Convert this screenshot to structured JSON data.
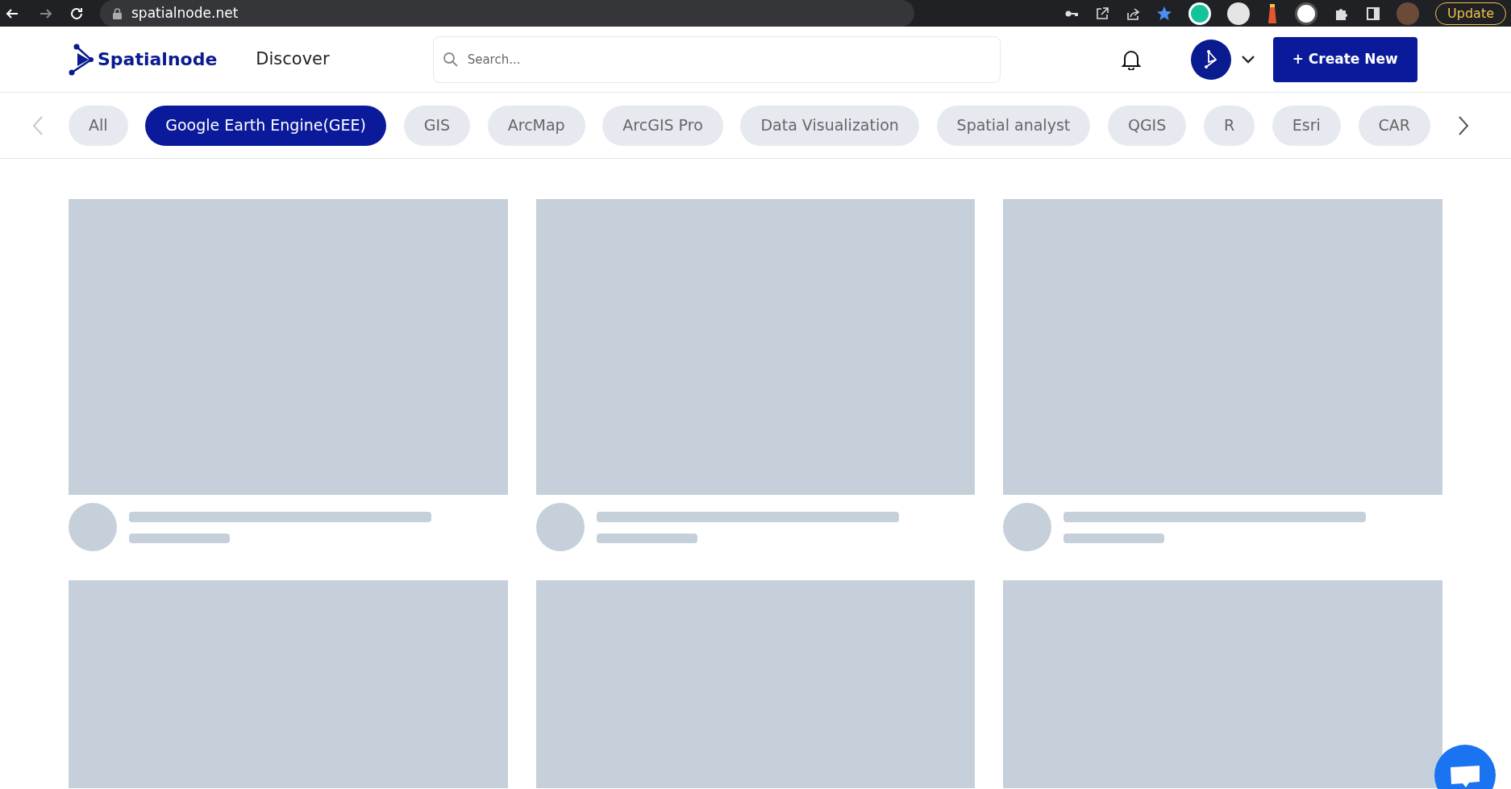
{
  "browser": {
    "url": "spatialnode.net",
    "update_button": "Update"
  },
  "header": {
    "brand": "Spatialnode",
    "nav_link": "Discover",
    "search": {
      "placeholder": "Search..."
    },
    "create_button": "+ Create New"
  },
  "categories": {
    "prev_disabled": true,
    "next_disabled": false,
    "chips": [
      {
        "label": "All",
        "selected": false
      },
      {
        "label": "Google Earth Engine(GEE)",
        "selected": true
      },
      {
        "label": "GIS",
        "selected": false
      },
      {
        "label": "ArcMap",
        "selected": false
      },
      {
        "label": "ArcGIS Pro",
        "selected": false
      },
      {
        "label": "Data Visualization",
        "selected": false
      },
      {
        "label": "Spatial analyst",
        "selected": false
      },
      {
        "label": "QGIS",
        "selected": false
      },
      {
        "label": "R",
        "selected": false
      },
      {
        "label": "Esri",
        "selected": false
      },
      {
        "label": "CAR",
        "selected": false
      }
    ]
  }
}
